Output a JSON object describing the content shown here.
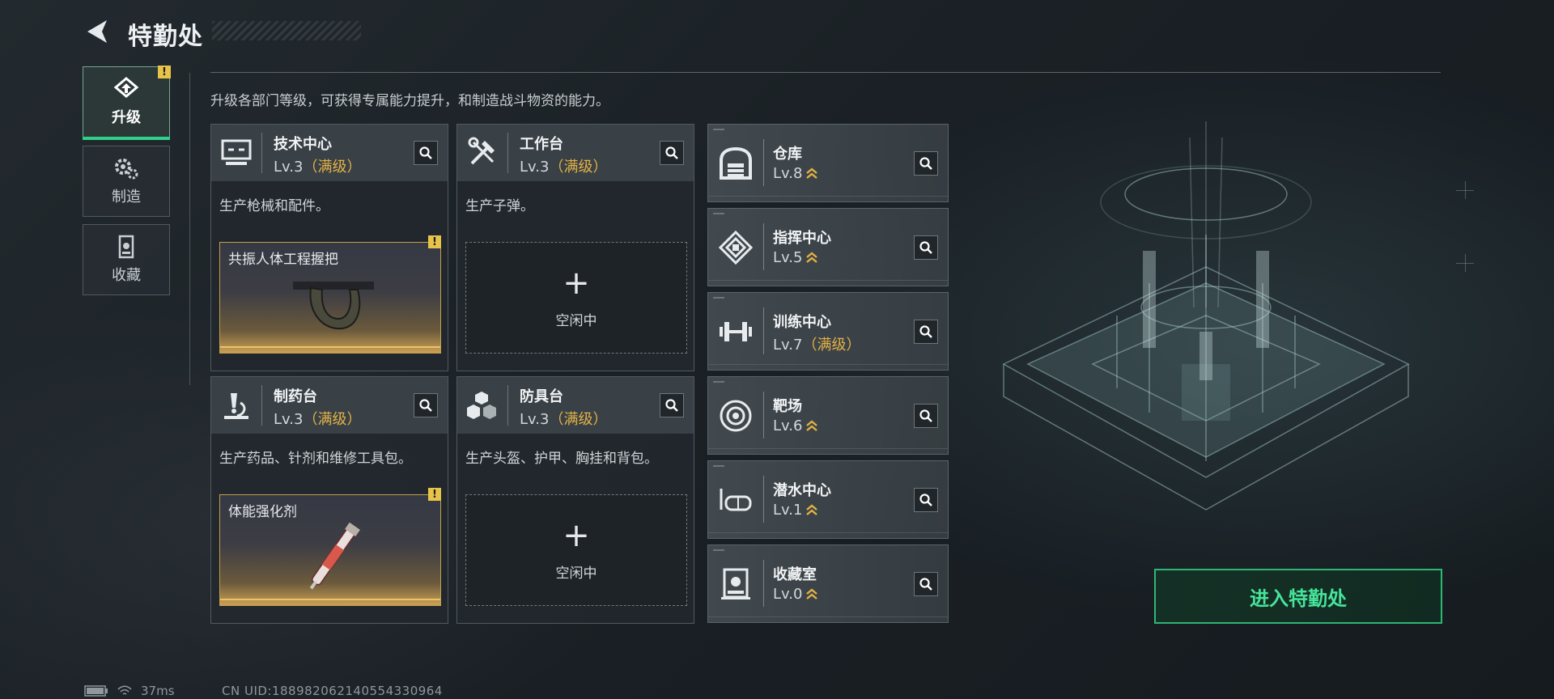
{
  "header": {
    "title": "特勤处"
  },
  "sidebar": {
    "tabs": [
      {
        "id": "upgrade",
        "label": "升级",
        "active": true,
        "warning": "!"
      },
      {
        "id": "craft",
        "label": "制造",
        "active": false
      },
      {
        "id": "collection",
        "label": "收藏",
        "active": false
      }
    ]
  },
  "main": {
    "description": "升级各部门等级，可获得专属能力提升，和制造战斗物资的能力。",
    "workstations": [
      {
        "name": "技术中心",
        "level": "Lv.3",
        "maxed_tag": "（满级）",
        "desc": "生产枪械和配件。",
        "slot": {
          "state": "item",
          "item_name": "共振人体工程握把",
          "warning": "!"
        }
      },
      {
        "name": "工作台",
        "level": "Lv.3",
        "maxed_tag": "（满级）",
        "desc": "生产子弹。",
        "slot": {
          "state": "idle",
          "plus": "+",
          "label": "空闲中"
        }
      },
      {
        "name": "制药台",
        "level": "Lv.3",
        "maxed_tag": "（满级）",
        "desc": "生产药品、针剂和维修工具包。",
        "slot": {
          "state": "item",
          "item_name": "体能强化剂",
          "warning": "!"
        }
      },
      {
        "name": "防具台",
        "level": "Lv.3",
        "maxed_tag": "（满级）",
        "desc": "生产头盔、护甲、胸挂和背包。",
        "slot": {
          "state": "idle",
          "plus": "+",
          "label": "空闲中"
        }
      }
    ],
    "facilities": [
      {
        "name": "仓库",
        "level": "Lv.8",
        "maxed_tag": "",
        "upgradable": true
      },
      {
        "name": "指挥中心",
        "level": "Lv.5",
        "maxed_tag": "",
        "upgradable": true
      },
      {
        "name": "训练中心",
        "level": "Lv.7",
        "maxed_tag": "（满级）",
        "upgradable": false
      },
      {
        "name": "靶场",
        "level": "Lv.6",
        "maxed_tag": "",
        "upgradable": true
      },
      {
        "name": "潜水中心",
        "level": "Lv.1",
        "maxed_tag": "",
        "upgradable": true
      },
      {
        "name": "收藏室",
        "level": "Lv.0",
        "maxed_tag": "",
        "upgradable": true
      }
    ]
  },
  "enter_button": {
    "label": "进入特勤处"
  },
  "status": {
    "ping": "37ms",
    "uid": "CN UID:1889820621405543309​64"
  },
  "colors": {
    "accent_green": "#2fb575",
    "maxed_gold": "#e3b245",
    "warning_yellow": "#e8c34a"
  }
}
